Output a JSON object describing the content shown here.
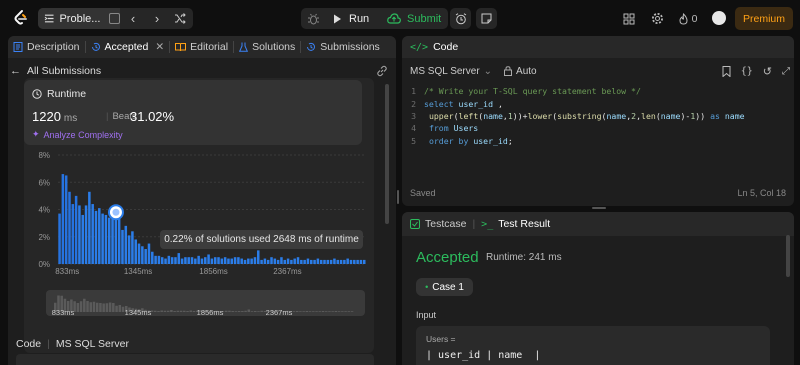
{
  "topbar": {
    "problem_label": "Proble...",
    "run_label": "Run",
    "submit_label": "Submit",
    "notif_count": "0",
    "premium_label": "Premium"
  },
  "tabs": [
    {
      "label": "Description"
    },
    {
      "label": "Accepted"
    },
    {
      "label": "Editorial"
    },
    {
      "label": "Solutions"
    },
    {
      "label": "Submissions"
    }
  ],
  "back_label": "All Submissions",
  "runtime": {
    "title": "Runtime",
    "value": "1220",
    "unit": "ms",
    "beats_label": "Beats",
    "beats_pct": "31.02%",
    "analyze": "Analyze Complexity"
  },
  "tooltip": "0.22% of solutions used 2648 ms of runtime",
  "code_footer": {
    "label": "Code",
    "lang": "MS SQL Server"
  },
  "editor": {
    "title": "Code",
    "lang": "MS SQL Server",
    "mode": "Auto",
    "lines": [
      {
        "n": "1",
        "text": "/* Write your T-SQL query statement below */"
      },
      {
        "n": "2",
        "text": "select user_id ,"
      },
      {
        "n": "3",
        "text": " upper(left(name,1))+lower(substring(name,2,len(name)-1)) as name"
      },
      {
        "n": "4",
        "text": " from Users"
      },
      {
        "n": "5",
        "text": " order by user_id;"
      }
    ],
    "saved": "Saved",
    "cursor": "Ln 5, Col 18"
  },
  "test": {
    "testcase_label": "Testcase",
    "result_label": "Test Result",
    "status": "Accepted",
    "runtime": "Runtime: 241 ms",
    "case_label": "Case 1",
    "input_label": "Input",
    "input_var": "Users =",
    "input_header": "| user_id | name  |"
  },
  "chart_data": {
    "type": "bar",
    "y_ticks": [
      "8%",
      "6%",
      "4%",
      "2%",
      "0%"
    ],
    "ylim": [
      0,
      8
    ],
    "x_ticks": [
      "833ms",
      "1345ms",
      "1856ms",
      "2367ms"
    ],
    "mini_x_ticks": [
      "833ms",
      "1345ms",
      "1856ms",
      "2367ms"
    ],
    "highlight_index": 17,
    "values": [
      3.7,
      6.6,
      6.5,
      5.3,
      4.4,
      5.0,
      4.3,
      3.6,
      4.3,
      5.3,
      4.4,
      3.9,
      4.1,
      3.7,
      3.6,
      3.4,
      3.5,
      3.8,
      3.6,
      2.5,
      2.8,
      2.1,
      2.4,
      1.8,
      1.5,
      1.3,
      1.1,
      1.5,
      0.9,
      0.6,
      0.6,
      0.5,
      0.4,
      0.6,
      0.5,
      0.5,
      0.8,
      0.4,
      0.5,
      0.5,
      0.5,
      0.4,
      0.6,
      0.4,
      0.5,
      0.7,
      0.4,
      0.5,
      0.5,
      0.4,
      0.5,
      0.4,
      0.4,
      0.5,
      0.5,
      0.4,
      0.3,
      0.4,
      0.4,
      0.5,
      1.0,
      0.3,
      0.4,
      0.3,
      0.5,
      0.4,
      0.3,
      0.5,
      0.3,
      0.4,
      0.3,
      0.4,
      0.5,
      0.3,
      0.3,
      0.4,
      0.3,
      0.3,
      0.4,
      0.3,
      0.3,
      0.3,
      0.3,
      0.4,
      0.3,
      0.3,
      0.3,
      0.4,
      0.3,
      0.3,
      0.3,
      0.3,
      0.3
    ]
  }
}
